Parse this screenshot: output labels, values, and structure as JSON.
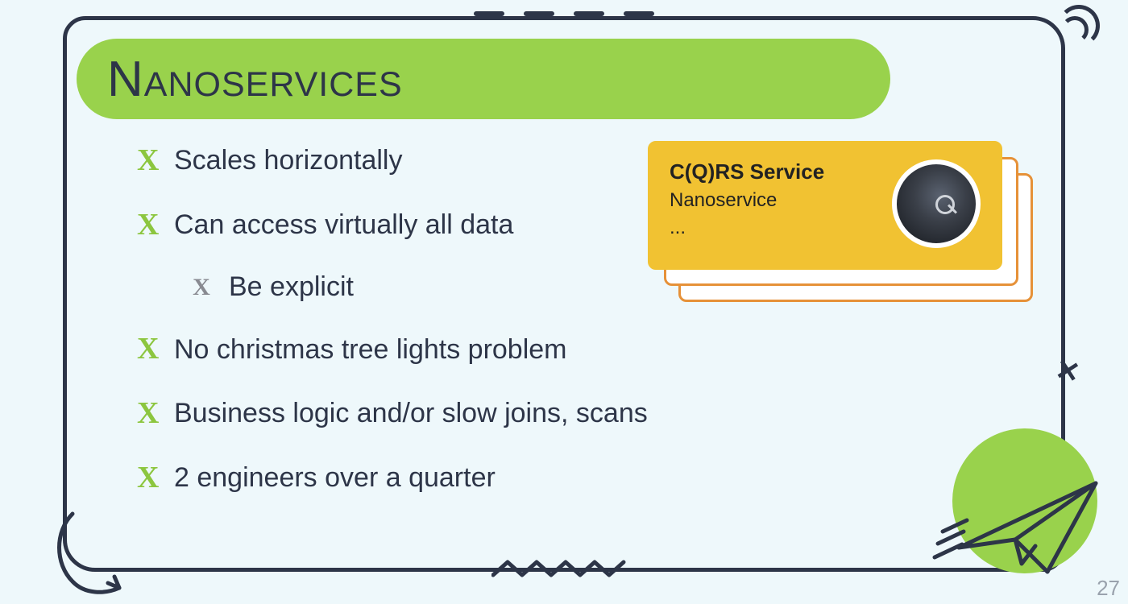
{
  "title": "Nanoservices",
  "bullets": [
    {
      "text": "Scales horizontally",
      "style": "green"
    },
    {
      "text": "Can access virtually all data",
      "style": "green"
    },
    {
      "text": "Be explicit",
      "style": "gray",
      "indent": true
    },
    {
      "text": "No christmas tree lights problem",
      "style": "green"
    },
    {
      "text": "Business logic and/or slow joins, scans",
      "style": "green"
    },
    {
      "text": "2 engineers over a quarter",
      "style": "green"
    }
  ],
  "card": {
    "title": "C(Q)RS Service",
    "subtitle": "Nanoservice",
    "more": "..."
  },
  "page_number": "27"
}
